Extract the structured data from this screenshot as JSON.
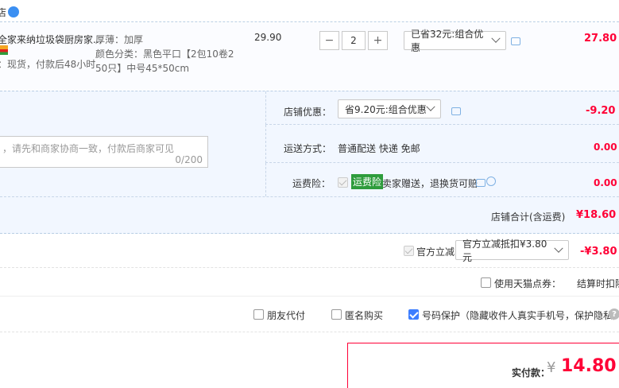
{
  "header": {
    "shop_suffix": "店"
  },
  "item": {
    "title": "全家来纳垃圾袋厨房家...",
    "stock": "：现货，付款后48小时",
    "attr_thickness": "厚薄：加厚",
    "attr_color_line1": "颜色分类：黑色平口【2包10卷2",
    "attr_color_line2": "50只】中号45*50cm",
    "unit_price": "29.90",
    "quantity": "2",
    "minus": "−",
    "plus": "+",
    "promo_select": "已省32元:组合优惠",
    "subtotal": "27.80"
  },
  "message": {
    "placeholder": "，请先和商家协商一致，付款后商家可见",
    "counter": "0/200"
  },
  "shop": {
    "discount_label": "店铺优惠：",
    "discount_select": "省9.20元:组合优惠",
    "discount_value": "-9.20",
    "shipping_label": "运送方式：",
    "shipping_method": "普通配送 快递 免邮",
    "shipping_value": "0.00",
    "insurance_label": "运费险：",
    "insurance_badge": "运费险",
    "insurance_text": "卖家赠送，退换货可赔",
    "insurance_value": "0.00",
    "total_label": "店铺合计(含运费)",
    "total_value": "¥18.60"
  },
  "official": {
    "label": "官方立减",
    "select": "官方立减抵扣¥3.80元",
    "value": "-¥3.80"
  },
  "points": {
    "label": "使用天猫点券：",
    "note": "结算时扣除"
  },
  "options": {
    "friend_pay": "朋友代付",
    "anonymous": "匿名购买",
    "number_protect": "号码保护（隐藏收件人真实手机号，保护隐私）",
    "help": "?"
  },
  "pay": {
    "label": "实付款：",
    "currency": "¥",
    "amount": "14.80"
  },
  "colors": {
    "accent_red": "#ff0036",
    "band_blue": "#f2f7ff",
    "border_blue": "#b7cde4",
    "insurance_green": "#2e9c3c"
  }
}
